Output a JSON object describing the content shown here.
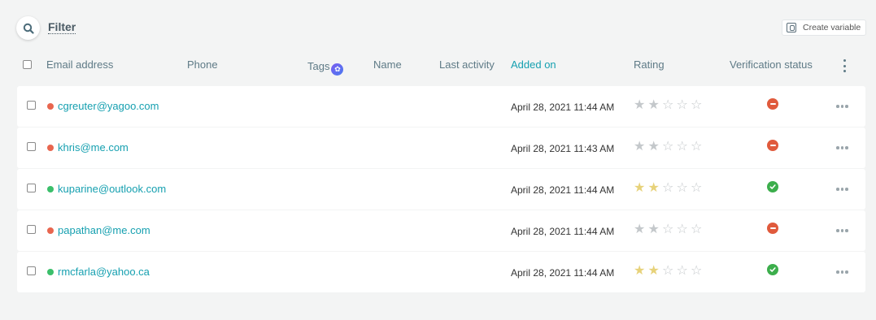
{
  "toolbar": {
    "search_icon": "search-icon",
    "filter_label": "Filter",
    "create_variable_label": "Create variable",
    "create_variable_icon": "variable-icon"
  },
  "header": {
    "select_all": false,
    "columns": {
      "email": "Email address",
      "phone": "Phone",
      "tags": "Tags",
      "name": "Name",
      "last_activity": "Last activity",
      "added_on": "Added on",
      "rating": "Rating",
      "verification": "Verification status"
    },
    "tags_badge_icon": "star-badge-icon",
    "menu_icon": "kebab-menu-icon"
  },
  "colors": {
    "accent": "#16a0b0",
    "status_unverified": "#e8664f",
    "status_verified": "#3bbf6b",
    "verif_invalid": "#e05a3c",
    "verif_valid": "#3cae4c",
    "star_gold": "#e7d27a",
    "star_gray": "#c4c8cb"
  },
  "rows": [
    {
      "email": "cgreuter@yagoo.com",
      "status": "red",
      "added_on": "April 28, 2021 11:44 AM",
      "rating": 2,
      "rating_color": "gray",
      "verification": "invalid"
    },
    {
      "email": "khris@me.com",
      "status": "red",
      "added_on": "April 28, 2021 11:43 AM",
      "rating": 2,
      "rating_color": "gray",
      "verification": "invalid"
    },
    {
      "email": "kuparine@outlook.com",
      "status": "green",
      "added_on": "April 28, 2021 11:44 AM",
      "rating": 2,
      "rating_color": "gold",
      "verification": "valid"
    },
    {
      "email": "papathan@me.com",
      "status": "red",
      "added_on": "April 28, 2021 11:44 AM",
      "rating": 2,
      "rating_color": "gray",
      "verification": "invalid"
    },
    {
      "email": "rmcfarla@yahoo.ca",
      "status": "green",
      "added_on": "April 28, 2021 11:44 AM",
      "rating": 2,
      "rating_color": "gold",
      "verification": "valid"
    }
  ]
}
